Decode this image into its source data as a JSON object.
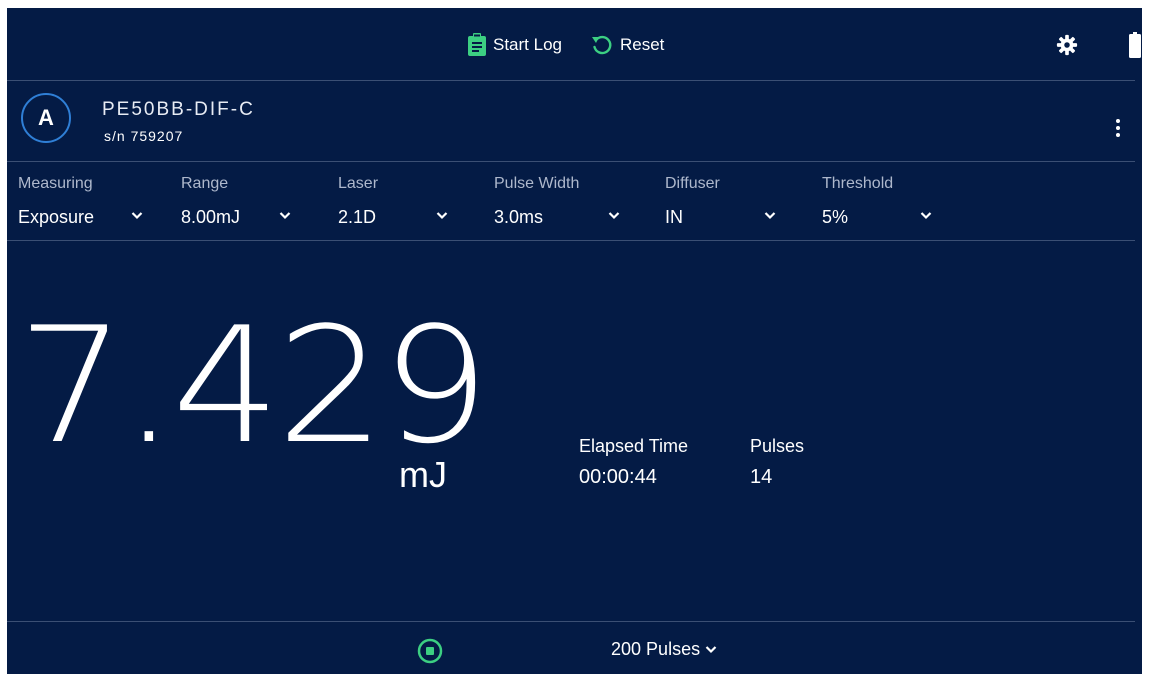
{
  "toolbar": {
    "start_log_label": "Start Log",
    "reset_label": "Reset",
    "accent_color": "#3ccf82"
  },
  "device": {
    "channel": "A",
    "model": "PE50BB-DIF-C",
    "serial": "s/n 759207"
  },
  "settings": [
    {
      "label": "Measuring",
      "value": "Exposure"
    },
    {
      "label": "Range",
      "value": "8.00mJ"
    },
    {
      "label": "Laser",
      "value": "2.1D"
    },
    {
      "label": "Pulse Width",
      "value": "3.0ms"
    },
    {
      "label": "Diffuser",
      "value": "IN"
    },
    {
      "label": "Threshold",
      "value": "5%"
    }
  ],
  "reading": {
    "value": "7.429",
    "unit": "mJ",
    "elapsed_label": "Elapsed Time",
    "elapsed_value": "00:00:44",
    "pulses_label": "Pulses",
    "pulses_value": "14"
  },
  "footer": {
    "pulse_count": "200",
    "pulse_unit": "Pulses"
  },
  "colors": {
    "background": "#041b45",
    "accent": "#3ccf82",
    "badge_ring": "#2f7fd6"
  }
}
